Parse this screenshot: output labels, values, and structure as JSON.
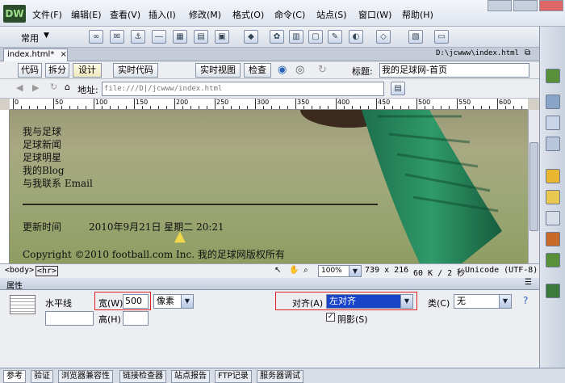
{
  "menubar": {
    "items": [
      "文件(F)",
      "编辑(E)",
      "查看(V)",
      "插入(I)",
      "修改(M)",
      "格式(O)",
      "命令(C)",
      "站点(S)",
      "窗口(W)",
      "帮助(H)"
    ],
    "logo": "DW"
  },
  "insertbar": {
    "category": "常用"
  },
  "document": {
    "tab": "index.html*",
    "path": "D:\\jcwww\\index.html"
  },
  "viewbar": {
    "code": "代码",
    "split": "拆分",
    "design": "设计",
    "live_code": "实时代码",
    "live_view": "实时视图",
    "inspect": "检查",
    "title_label": "标题:",
    "title_value": "我的足球网-首页"
  },
  "address": {
    "label": "地址:",
    "value": "file:///D|/jcwww/index.html"
  },
  "ruler": {
    "ticks": [
      "0",
      "50",
      "100",
      "150",
      "200",
      "250",
      "300",
      "350",
      "400",
      "450",
      "500",
      "550",
      "600"
    ]
  },
  "page": {
    "nav": [
      "我与足球",
      "足球新闻",
      "足球明星",
      "我的Blog",
      "与我联系 Email"
    ],
    "update_label": "更新时间",
    "update_value": "2010年9月21日 星期二 20:21",
    "copyright": "Copyright ©2010 football.com Inc. 我的足球网版权所有"
  },
  "statusbar": {
    "tag_body": "<body>",
    "tag_hr": "<hr>",
    "zoom": "100%",
    "dimensions": "739 x 216",
    "size": "60 K / 2 秒",
    "encoding": "Unicode (UTF-8)"
  },
  "properties": {
    "panel_title": "属性",
    "element": "水平线",
    "width_label": "宽(W)",
    "width_value": "500",
    "unit": "像素",
    "height_label": "高(H)",
    "height_value": "",
    "align_label": "对齐(A)",
    "align_value": "左对齐",
    "shade_label": "阴影(S)",
    "shade_checked": true,
    "class_label": "类(C)",
    "class_value": "无"
  },
  "bottom_tabs": [
    "参考",
    "验证",
    "浏览器兼容性",
    "链接检查器",
    "站点报告",
    "FTP记录",
    "服务器调试"
  ],
  "colors": {
    "accent": "#2b4d2b",
    "highlight_red": "#e02020",
    "selected_blue": "#1a44c8"
  }
}
